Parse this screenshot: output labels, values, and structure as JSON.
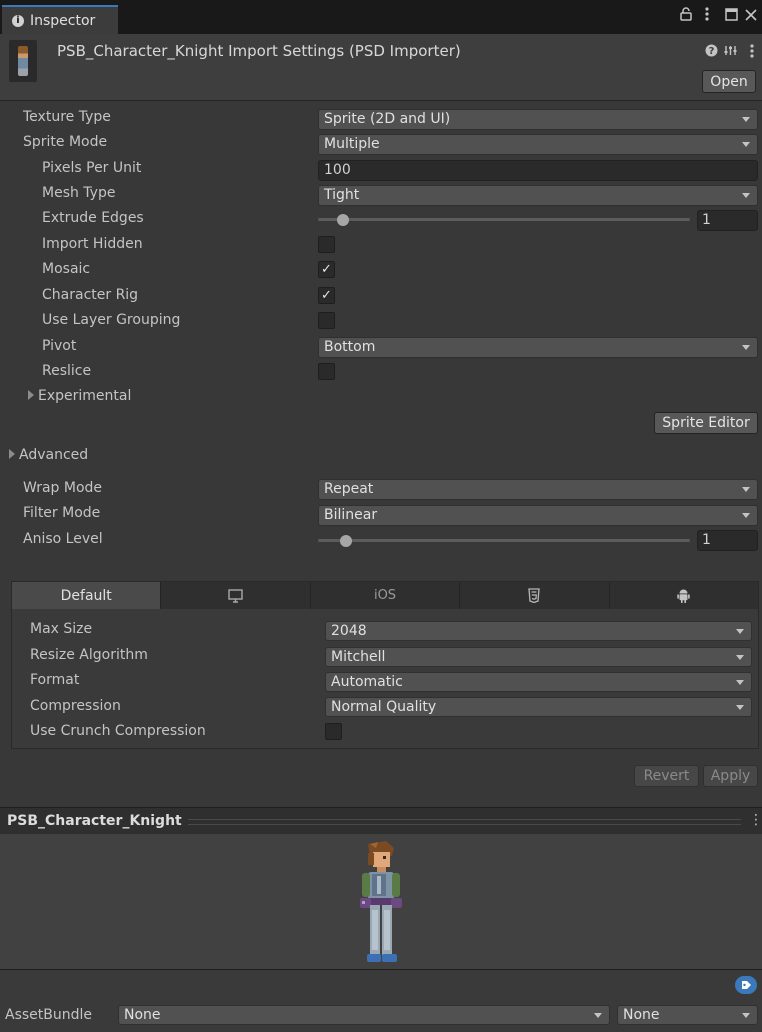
{
  "window": {
    "tab_label": "Inspector",
    "icons": [
      "lock-icon",
      "kebab-menu-icon",
      "maximize-icon",
      "close-icon"
    ]
  },
  "header": {
    "title": "PSB_Character_Knight Import Settings (PSD Importer)",
    "open_label": "Open",
    "icons": [
      "help-icon",
      "presets-icon",
      "kebab-menu-icon"
    ]
  },
  "settings": {
    "texture_type": {
      "label": "Texture Type",
      "value": "Sprite (2D and UI)"
    },
    "sprite_mode": {
      "label": "Sprite Mode",
      "value": "Multiple"
    },
    "pixels_per_unit": {
      "label": "Pixels Per Unit",
      "value": "100"
    },
    "mesh_type": {
      "label": "Mesh Type",
      "value": "Tight"
    },
    "extrude_edges": {
      "label": "Extrude Edges",
      "value": "1",
      "slider_fraction": 0.05
    },
    "import_hidden": {
      "label": "Import Hidden",
      "checked": false
    },
    "mosaic": {
      "label": "Mosaic",
      "checked": true
    },
    "character_rig": {
      "label": "Character Rig",
      "checked": true
    },
    "use_layer_grouping": {
      "label": "Use Layer Grouping",
      "checked": false
    },
    "pivot": {
      "label": "Pivot",
      "value": "Bottom"
    },
    "reslice": {
      "label": "Reslice",
      "checked": false
    },
    "experimental": {
      "label": "Experimental"
    },
    "sprite_editor_label": "Sprite Editor",
    "check_glyph": "✓"
  },
  "advanced": {
    "label": "Advanced",
    "wrap_mode": {
      "label": "Wrap Mode",
      "value": "Repeat"
    },
    "filter_mode": {
      "label": "Filter Mode",
      "value": "Bilinear"
    },
    "aniso_level": {
      "label": "Aniso Level",
      "value": "1",
      "slider_fraction": 0.06
    }
  },
  "platform": {
    "tabs": [
      {
        "label": "Default",
        "active": true
      },
      {
        "icon": "monitor-icon"
      },
      {
        "label": "iOS"
      },
      {
        "icon": "html5-icon"
      },
      {
        "icon": "android-icon"
      }
    ],
    "max_size": {
      "label": "Max Size",
      "value": "2048"
    },
    "resize_algorithm": {
      "label": "Resize Algorithm",
      "value": "Mitchell"
    },
    "format": {
      "label": "Format",
      "value": "Automatic"
    },
    "compression": {
      "label": "Compression",
      "value": "Normal Quality"
    },
    "use_crunch": {
      "label": "Use Crunch Compression",
      "checked": false
    }
  },
  "actions": {
    "revert_label": "Revert",
    "apply_label": "Apply"
  },
  "preview": {
    "title": "PSB_Character_Knight",
    "menu_glyph": "⋮"
  },
  "asset_bundle": {
    "label": "AssetBundle",
    "name_value": "None",
    "variant_value": "None"
  }
}
